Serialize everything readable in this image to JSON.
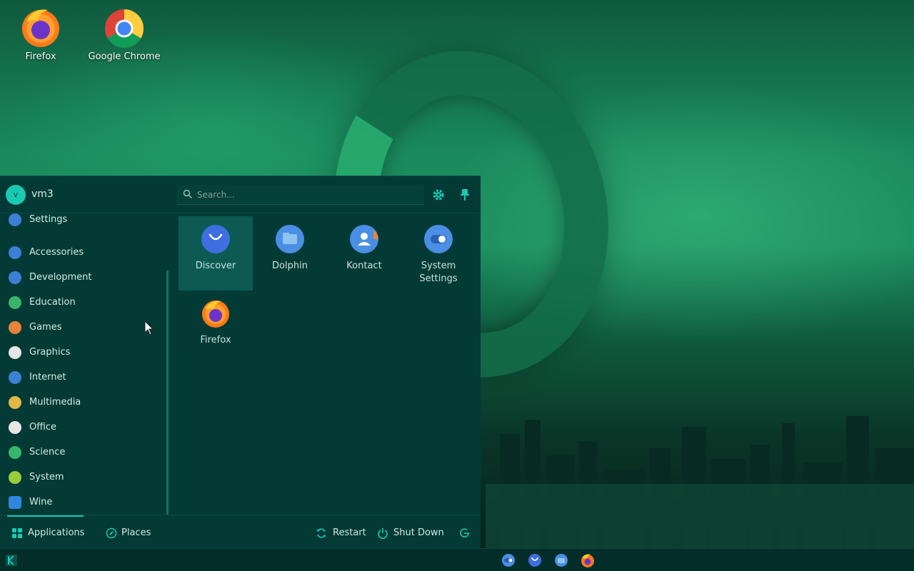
{
  "desktop": {
    "icons": [
      {
        "label": "Firefox",
        "icon": "firefox-icon"
      },
      {
        "label": "Google Chrome",
        "icon": "chrome-icon"
      }
    ]
  },
  "launcher": {
    "user": {
      "initial": "v",
      "name": "vm3"
    },
    "search": {
      "placeholder": "Search..."
    },
    "categories": [
      {
        "label": "Settings",
        "icon": "settings-icon",
        "color": "#3e7fd6"
      },
      {
        "label": "Accessories",
        "icon": "accessories-icon",
        "color": "#3e7fd6"
      },
      {
        "label": "Development",
        "icon": "development-icon",
        "color": "#3e7fd6"
      },
      {
        "label": "Education",
        "icon": "education-icon",
        "color": "#38b56a"
      },
      {
        "label": "Games",
        "icon": "games-icon",
        "color": "#e8833a"
      },
      {
        "label": "Graphics",
        "icon": "graphics-icon",
        "color": "#e6e6e6"
      },
      {
        "label": "Internet",
        "icon": "internet-icon",
        "color": "#3e7fd6"
      },
      {
        "label": "Multimedia",
        "icon": "multimedia-icon",
        "color": "#e0b84a"
      },
      {
        "label": "Office",
        "icon": "office-icon",
        "color": "#e6e6e6"
      },
      {
        "label": "Science",
        "icon": "science-icon",
        "color": "#38b56a"
      },
      {
        "label": "System",
        "icon": "system-icon",
        "color": "#9acb3a"
      },
      {
        "label": "Wine",
        "icon": "wine-icon",
        "color": "#2e86de"
      }
    ],
    "apps": [
      {
        "label": "Discover",
        "icon": "discover-icon"
      },
      {
        "label": "Dolphin",
        "icon": "dolphin-icon"
      },
      {
        "label": "Kontact",
        "icon": "kontact-icon"
      },
      {
        "label": "System Settings",
        "icon": "system-settings-icon"
      },
      {
        "label": "Firefox",
        "icon": "firefox-icon"
      }
    ],
    "footer": {
      "applications": "Applications",
      "places": "Places",
      "restart": "Restart",
      "shutdown": "Shut Down"
    }
  },
  "colors": {
    "panel_bg": "#033a35",
    "accent": "#19c9b3",
    "selected_bg": "#0c5a52"
  }
}
